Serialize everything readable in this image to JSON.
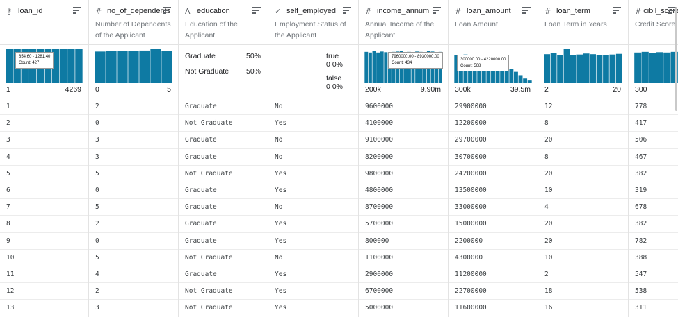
{
  "columns": [
    {
      "key": "loan_id",
      "icon": "key-icon",
      "glyph": "⚷",
      "name": "loan_id",
      "desc": "",
      "summary": {
        "kind": "hist",
        "bars": [
          1,
          1,
          1,
          1,
          1,
          1,
          1,
          1,
          1,
          1
        ],
        "min": "1",
        "max": "4269",
        "tooltip": {
          "line1": "854.60 - 1281.40",
          "line2": "Count: 427"
        }
      }
    },
    {
      "key": "no_of_dependents",
      "icon": "hash-icon",
      "glyph": "#",
      "name": "no_of_dependents",
      "desc": "Number of Dependents of the Applicant",
      "summary": {
        "kind": "hist",
        "bars": [
          0.93,
          0.95,
          0.94,
          0.95,
          0.96,
          1.0,
          0.95
        ],
        "min": "0",
        "max": "5"
      }
    },
    {
      "key": "education",
      "icon": "string-icon",
      "glyph": "A",
      "name": "education",
      "desc": "Education of the Applicant",
      "summary": {
        "kind": "cat",
        "items": [
          {
            "label": "Graduate",
            "pct": "50%"
          },
          {
            "label": "Not Graduate",
            "pct": "50%"
          }
        ]
      }
    },
    {
      "key": "self_employed",
      "icon": "check-icon",
      "glyph": "✓",
      "name": "self_employed",
      "desc": "Employment Status of the Applicant",
      "summary": {
        "kind": "bool",
        "items": [
          {
            "label": "true",
            "count": "0",
            "pct": "0%"
          },
          {
            "label": "false",
            "count": "0",
            "pct": "0%"
          }
        ]
      }
    },
    {
      "key": "income_annum",
      "icon": "hash-icon",
      "glyph": "#",
      "name": "income_annum",
      "desc": "Annual Income of the Applicant",
      "summary": {
        "kind": "hist",
        "bars": [
          0.92,
          0.9,
          0.94,
          0.9,
          0.93,
          0.91,
          0.9,
          0.92,
          0.93,
          0.95,
          0.91,
          0.92,
          0.9,
          0.93,
          0.92,
          0.91,
          0.94,
          0.93,
          0.9,
          0.92
        ],
        "min": "200k",
        "max": "9.90m",
        "tooltip": {
          "line1": "7960000.00 - 8930000.00",
          "line2": "Count: 434"
        }
      }
    },
    {
      "key": "loan_amount",
      "icon": "hash-icon",
      "glyph": "#",
      "name": "loan_amount",
      "desc": "Loan Amount",
      "summary": {
        "kind": "hist",
        "bars": [
          0.82,
          0.8,
          0.84,
          0.83,
          0.78,
          0.8,
          0.82,
          0.76,
          0.72,
          0.66,
          0.6,
          0.55,
          0.4,
          0.32,
          0.22,
          0.12,
          0.06
        ],
        "min": "300k",
        "max": "39.5m",
        "tooltip": {
          "line1": "300000.00 - 4220000.00",
          "line2": "Count: 568"
        }
      }
    },
    {
      "key": "loan_term",
      "icon": "hash-icon",
      "glyph": "#",
      "name": "loan_term",
      "desc": "Loan Term in Years",
      "summary": {
        "kind": "hist",
        "bars": [
          0.85,
          0.88,
          0.83,
          1.0,
          0.82,
          0.84,
          0.87,
          0.85,
          0.83,
          0.82,
          0.84,
          0.86
        ],
        "min": "2",
        "max": "20"
      }
    },
    {
      "key": "cibil_score",
      "icon": "hash-icon",
      "glyph": "#",
      "name": "cibil_score",
      "desc": "Credit Score",
      "summary": {
        "kind": "hist",
        "bars": [
          0.9,
          0.92,
          0.88,
          0.91,
          0.9,
          0.92
        ],
        "min": "300",
        "max": ""
      }
    }
  ],
  "rows": [
    [
      "1",
      "2",
      "Graduate",
      "No",
      "9600000",
      "29900000",
      "12",
      "778"
    ],
    [
      "2",
      "0",
      "Not Graduate",
      "Yes",
      "4100000",
      "12200000",
      "8",
      "417"
    ],
    [
      "3",
      "3",
      "Graduate",
      "No",
      "9100000",
      "29700000",
      "20",
      "506"
    ],
    [
      "4",
      "3",
      "Graduate",
      "No",
      "8200000",
      "30700000",
      "8",
      "467"
    ],
    [
      "5",
      "5",
      "Not Graduate",
      "Yes",
      "9800000",
      "24200000",
      "20",
      "382"
    ],
    [
      "6",
      "0",
      "Graduate",
      "Yes",
      "4800000",
      "13500000",
      "10",
      "319"
    ],
    [
      "7",
      "5",
      "Graduate",
      "No",
      "8700000",
      "33000000",
      "4",
      "678"
    ],
    [
      "8",
      "2",
      "Graduate",
      "Yes",
      "5700000",
      "15000000",
      "20",
      "382"
    ],
    [
      "9",
      "0",
      "Graduate",
      "Yes",
      "800000",
      "2200000",
      "20",
      "782"
    ],
    [
      "10",
      "5",
      "Not Graduate",
      "No",
      "1100000",
      "4300000",
      "10",
      "388"
    ],
    [
      "11",
      "4",
      "Graduate",
      "Yes",
      "2900000",
      "11200000",
      "2",
      "547"
    ],
    [
      "12",
      "2",
      "Not Graduate",
      "Yes",
      "6700000",
      "22700000",
      "18",
      "538"
    ],
    [
      "13",
      "3",
      "Not Graduate",
      "Yes",
      "5000000",
      "11600000",
      "16",
      "311"
    ]
  ],
  "colors": {
    "bar": "#0e7aa3",
    "border": "#e3e3e3"
  }
}
